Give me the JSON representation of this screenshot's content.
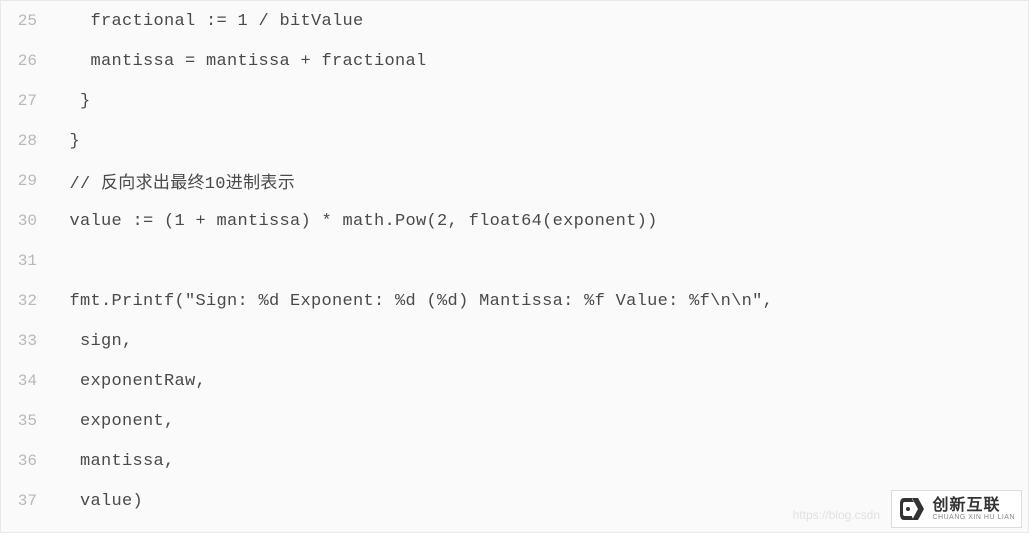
{
  "code": {
    "lines": [
      {
        "num": "25",
        "content": "   fractional := 1 / bitValue"
      },
      {
        "num": "26",
        "content": "   mantissa = mantissa + fractional"
      },
      {
        "num": "27",
        "content": "  }"
      },
      {
        "num": "28",
        "content": " }"
      },
      {
        "num": "29",
        "content": " // 反向求出最终10进制表示"
      },
      {
        "num": "30",
        "content": " value := (1 + mantissa) * math.Pow(2, float64(exponent))"
      },
      {
        "num": "31",
        "content": ""
      },
      {
        "num": "32",
        "content": " fmt.Printf(\"Sign: %d Exponent: %d (%d) Mantissa: %f Value: %f\\n\\n\","
      },
      {
        "num": "33",
        "content": "  sign,"
      },
      {
        "num": "34",
        "content": "  exponentRaw,"
      },
      {
        "num": "35",
        "content": "  exponent,"
      },
      {
        "num": "36",
        "content": "  mantissa,"
      },
      {
        "num": "37",
        "content": "  value)"
      }
    ]
  },
  "watermark": {
    "url": "https://blog.csdn",
    "logo_main": "创新互联",
    "logo_sub": "CHUANG XIN HU LIAN"
  }
}
